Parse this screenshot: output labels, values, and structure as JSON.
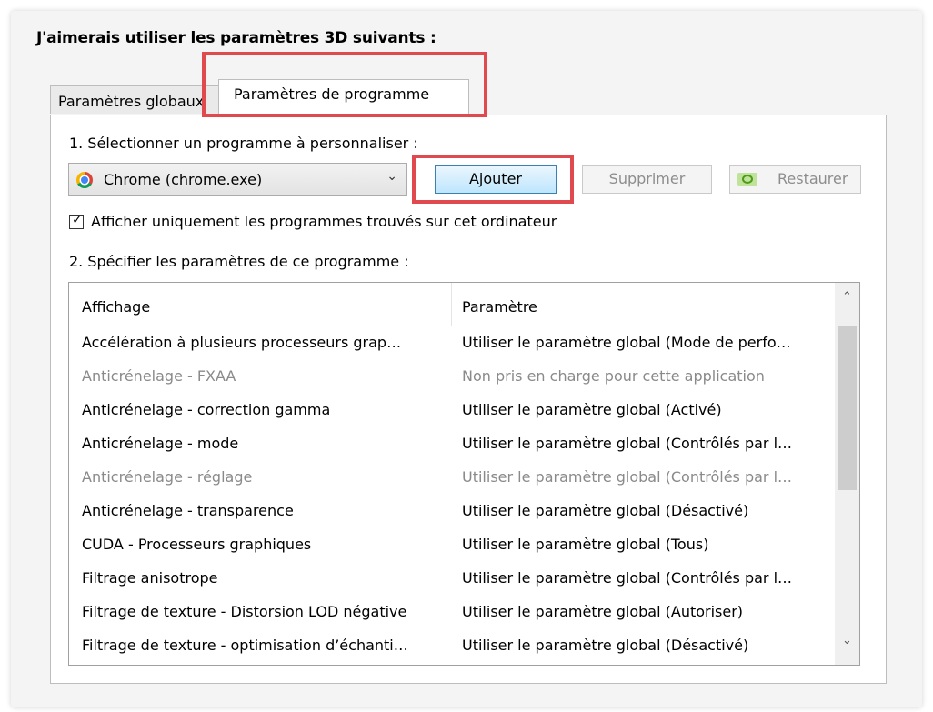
{
  "heading": "J'aimerais utiliser les paramètres 3D suivants :",
  "tabs": [
    {
      "label": "Paramètres globaux",
      "active": false
    },
    {
      "label": "Paramètres de programme",
      "active": true
    }
  ],
  "step1_label": "1. Sélectionner un programme à personnaliser :",
  "program_select": {
    "value": "Chrome (chrome.exe)",
    "icon": "chrome-icon"
  },
  "buttons": {
    "add": "Ajouter",
    "remove": "Supprimer",
    "restore": "Restaurer"
  },
  "checkbox": {
    "label": "Afficher uniquement les programmes trouvés sur cet ordinateur",
    "checked": true
  },
  "step2_label": "2. Spécifier les paramètres de ce programme :",
  "table": {
    "columns": [
      "Affichage",
      "Paramètre"
    ],
    "rows": [
      {
        "feature": "Accélération à plusieurs processeurs grap…",
        "setting": "Utiliser le paramètre global (Mode de perfo…",
        "disabled": false
      },
      {
        "feature": "Anticrénelage - FXAA",
        "setting": "Non pris en charge pour cette application",
        "disabled": true
      },
      {
        "feature": "Anticrénelage - correction gamma",
        "setting": "Utiliser le paramètre global (Activé)",
        "disabled": false
      },
      {
        "feature": "Anticrénelage - mode",
        "setting": "Utiliser le paramètre global (Contrôlés par l…",
        "disabled": false
      },
      {
        "feature": "Anticrénelage - réglage",
        "setting": "Utiliser le paramètre global (Contrôlés par l…",
        "disabled": true
      },
      {
        "feature": "Anticrénelage - transparence",
        "setting": "Utiliser le paramètre global (Désactivé)",
        "disabled": false
      },
      {
        "feature": "CUDA - Processeurs graphiques",
        "setting": "Utiliser le paramètre global (Tous)",
        "disabled": false
      },
      {
        "feature": "Filtrage anisotrope",
        "setting": "Utiliser le paramètre global (Contrôlés par l…",
        "disabled": false
      },
      {
        "feature": "Filtrage de texture - Distorsion LOD négative",
        "setting": "Utiliser le paramètre global (Autoriser)",
        "disabled": false
      },
      {
        "feature": "Filtrage de texture - optimisation d’échanti…",
        "setting": "Utiliser le paramètre global (Désactivé)",
        "disabled": false
      }
    ]
  },
  "colors": {
    "highlight": "#e04a4f",
    "disabled_text": "#8a8a8a"
  }
}
